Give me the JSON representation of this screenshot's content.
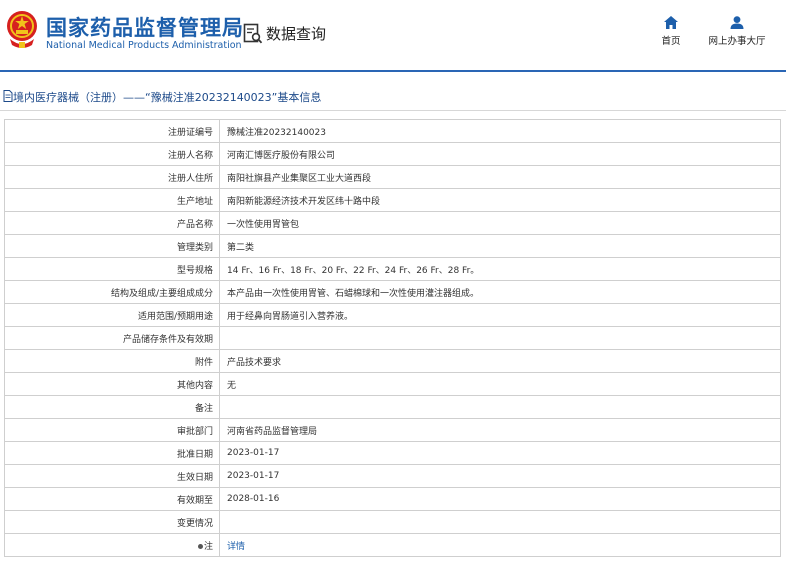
{
  "header": {
    "title_cn": "国家药品监督管理局",
    "title_en": "National Medical Products Administration",
    "query_label": "数据查询",
    "nav": [
      {
        "label": "首页",
        "icon": "home-icon"
      },
      {
        "label": "网上办事大厅",
        "icon": "user-icon"
      }
    ]
  },
  "breadcrumb": {
    "text": "境内医疗器械（注册）——“豫械注准20232140023”基本信息",
    "icon": "document-icon"
  },
  "colors": {
    "brand_blue": "#1d5fab",
    "divider_blue": "#2a66b5",
    "emblem_red": "#d6201f",
    "emblem_gold": "#f1c21b"
  },
  "rows": [
    {
      "label": "注册证编号",
      "value": "豫械注准20232140023"
    },
    {
      "label": "注册人名称",
      "value": "河南汇博医疗股份有限公司"
    },
    {
      "label": "注册人住所",
      "value": "南阳社旗县产业集聚区工业大道西段"
    },
    {
      "label": "生产地址",
      "value": "南阳新能源经济技术开发区纬十路中段"
    },
    {
      "label": "产品名称",
      "value": "一次性使用胃管包"
    },
    {
      "label": "管理类别",
      "value": "第二类"
    },
    {
      "label": "型号规格",
      "value": "14 Fr、16 Fr、18 Fr、20 Fr、22 Fr、24 Fr、26 Fr、28 Fr。"
    },
    {
      "label": "结构及组成/主要组成成分",
      "value": "本产品由一次性使用胃管、石蜡棉球和一次性使用灌注器组成。"
    },
    {
      "label": "适用范围/预期用途",
      "value": "用于经鼻向胃肠道引入营养液。"
    },
    {
      "label": "产品储存条件及有效期",
      "value": ""
    },
    {
      "label": "附件",
      "value": "产品技术要求"
    },
    {
      "label": "其他内容",
      "value": "无"
    },
    {
      "label": "备注",
      "value": ""
    },
    {
      "label": "审批部门",
      "value": "河南省药品监督管理局"
    },
    {
      "label": "批准日期",
      "value": "2023-01-17"
    },
    {
      "label": "生效日期",
      "value": "2023-01-17"
    },
    {
      "label": "有效期至",
      "value": "2028-01-16"
    },
    {
      "label": "变更情况",
      "value": ""
    }
  ],
  "note_row": {
    "label": "注",
    "value": "详情"
  }
}
